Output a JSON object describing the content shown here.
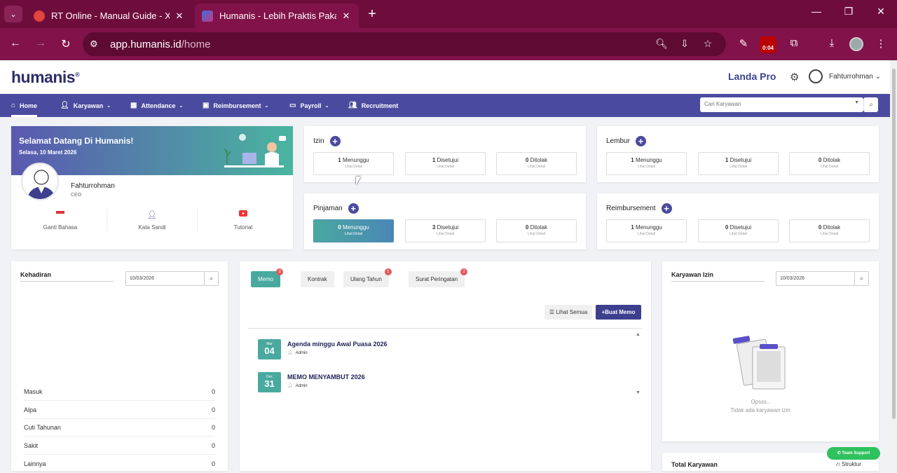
{
  "browser": {
    "tabs": [
      {
        "title": "RT Online - Manual Guide - Xmi",
        "favicon_color": "#e0443c"
      },
      {
        "title": "Humanis - Lebih Praktis Pakai H",
        "favicon_color": "#c13a8a"
      }
    ],
    "url_host": "app.humanis.id",
    "url_path": "/home",
    "extension_timer": "0:04"
  },
  "app": {
    "logo": "humanis",
    "company": "Landa Pro",
    "user": "Fahturrohman"
  },
  "nav": {
    "items": [
      {
        "label": "Home",
        "icon": "home-icon"
      },
      {
        "label": "Karyawan",
        "icon": "user-check-icon"
      },
      {
        "label": "Attendance",
        "icon": "calendar-icon"
      },
      {
        "label": "Reimbursement",
        "icon": "money-icon"
      },
      {
        "label": "Payroll",
        "icon": "wallet-icon"
      },
      {
        "label": "Recruitment",
        "icon": "users-icon"
      }
    ],
    "search_placeholder": "Cari Karyawan"
  },
  "welcome": {
    "title": "Selamat Datang Di Humanis!",
    "date": "Selasa, 10 Maret 2026",
    "name": "Fahturrohman",
    "role": "CEO",
    "actions": [
      {
        "label": "Ganti Bahasa",
        "icon": "flag-icon"
      },
      {
        "label": "Kata Sandi",
        "icon": "user-key-icon"
      },
      {
        "label": "Tutorial",
        "icon": "youtube-icon"
      }
    ]
  },
  "requests": {
    "izin": {
      "title": "Izin",
      "menunggu": "1",
      "disetujui": "1",
      "ditolak": "0"
    },
    "lembur": {
      "title": "Lembur",
      "menunggu": "1",
      "disetujui": "1",
      "ditolak": "0"
    },
    "pinjaman": {
      "title": "Pinjaman",
      "menunggu": "0",
      "disetujui": "3",
      "ditolak": "0"
    },
    "reimbursement": {
      "title": "Reimbursement",
      "menunggu": "1",
      "disetujui": "0",
      "ditolak": "0"
    },
    "labels": {
      "menunggu": "Menunggu",
      "disetujui": "Disetujui",
      "ditolak": "Ditolak",
      "detail": "Lihat Detail"
    }
  },
  "kehadiran": {
    "title": "Kehadiran",
    "date": "10/03/2026",
    "rows": [
      {
        "label": "Masuk",
        "value": "0"
      },
      {
        "label": "Alpa",
        "value": "0"
      },
      {
        "label": "Cuti Tahunan",
        "value": "0"
      },
      {
        "label": "Sakit",
        "value": "0"
      },
      {
        "label": "Lainnya",
        "value": "0"
      }
    ]
  },
  "memo": {
    "tabs": [
      {
        "label": "Memo",
        "badge": "2"
      },
      {
        "label": "Kontrak",
        "badge": ""
      },
      {
        "label": "Ulang Tahun",
        "badge": "1"
      },
      {
        "label": "Surat Peringatan",
        "badge": "2"
      }
    ],
    "lihat_semua": "Lihat Semua",
    "buat_memo": "Buat Memo",
    "items": [
      {
        "month": "Mar",
        "day": "04",
        "title": "Agenda minggu Awal Puasa 2026",
        "author": "Admin"
      },
      {
        "month": "Dec",
        "day": "31",
        "title": "MEMO MENYAMBUT 2026",
        "author": "Admin"
      }
    ]
  },
  "karyawan_izin": {
    "title": "Karyawan Izin",
    "date": "10/03/2026",
    "empty_title": "Opsss..",
    "empty_text": "Tidak ada karyawan izin"
  },
  "total_karyawan": {
    "title": "Total Karyawan",
    "struktur": "Struktur"
  },
  "team_support": "Team Support",
  "colors": {
    "primary": "#4a4b9e",
    "teal": "#49a99f",
    "browser": "#82124a"
  }
}
